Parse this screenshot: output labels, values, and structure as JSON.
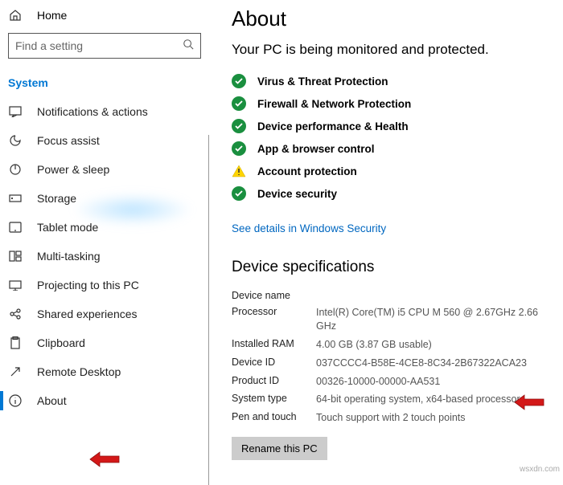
{
  "sidebar": {
    "home": "Home",
    "search_placeholder": "Find a setting",
    "category": "System",
    "items": [
      {
        "label": "Notifications & actions"
      },
      {
        "label": "Focus assist"
      },
      {
        "label": "Power & sleep"
      },
      {
        "label": "Storage"
      },
      {
        "label": "Tablet mode"
      },
      {
        "label": "Multi-tasking"
      },
      {
        "label": "Projecting to this PC"
      },
      {
        "label": "Shared experiences"
      },
      {
        "label": "Clipboard"
      },
      {
        "label": "Remote Desktop"
      },
      {
        "label": "About"
      }
    ]
  },
  "main": {
    "title": "About",
    "subtitle": "Your PC is being monitored and protected.",
    "status": [
      {
        "kind": "ok",
        "label": "Virus & Threat Protection"
      },
      {
        "kind": "ok",
        "label": "Firewall & Network Protection"
      },
      {
        "kind": "ok",
        "label": "Device performance & Health"
      },
      {
        "kind": "ok",
        "label": "App & browser control"
      },
      {
        "kind": "warn",
        "label": "Account protection"
      },
      {
        "kind": "ok",
        "label": "Device security"
      }
    ],
    "see_details": "See details in Windows Security",
    "specs_title": "Device specifications",
    "specs": [
      {
        "k": "Device name",
        "v": ""
      },
      {
        "k": "Processor",
        "v": "Intel(R) Core(TM) i5 CPU           M 560  @ 2.67GHz   2.66 GHz"
      },
      {
        "k": "Installed RAM",
        "v": "4.00 GB (3.87 GB usable)"
      },
      {
        "k": "Device ID",
        "v": "037CCCC4-B58E-4CE8-8C34-2B67322ACA23"
      },
      {
        "k": "Product ID",
        "v": "00326-10000-00000-AA531"
      },
      {
        "k": "System type",
        "v": "64-bit operating system, x64-based processor"
      },
      {
        "k": "Pen and touch",
        "v": "Touch support with 2 touch points"
      }
    ],
    "rename_btn": "Rename this PC"
  },
  "watermark": "wsxdn.com"
}
